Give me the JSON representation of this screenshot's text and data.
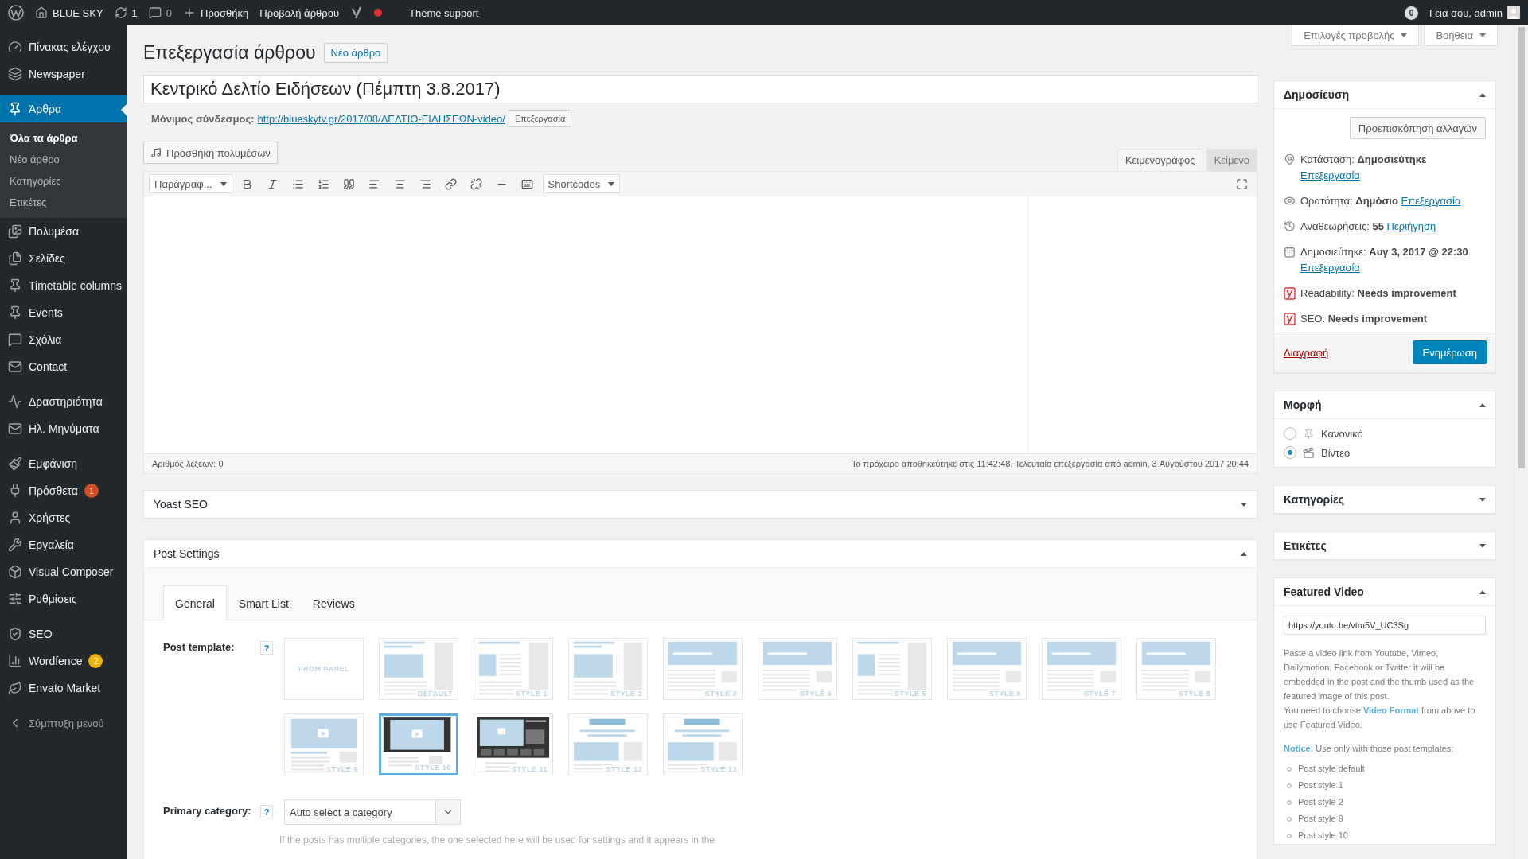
{
  "admin_bar": {
    "site": "BLUE SKY",
    "updates": "1",
    "comments": "0",
    "new": "Προσθήκη",
    "view": "Προβολή άρθρου",
    "theme_support": "Theme support",
    "notifications": "0",
    "greeting": "Γεια σου, admin"
  },
  "sidebar": {
    "groups": [
      [
        {
          "label": "Πίνακας ελέγχου",
          "selected": false
        },
        {
          "label": "Newspaper",
          "selected": false
        }
      ],
      [
        {
          "label": "Άρθρα",
          "selected": true,
          "children": [
            {
              "label": "Όλα τα άρθρα",
              "selected": true
            },
            {
              "label": "Νέο άρθρο",
              "selected": false
            },
            {
              "label": "Κατηγορίες",
              "selected": false
            },
            {
              "label": "Ετικέτες",
              "selected": false
            }
          ]
        },
        {
          "label": "Πολυμέσα",
          "selected": false
        },
        {
          "label": "Σελίδες",
          "selected": false
        },
        {
          "label": "Timetable columns",
          "selected": false
        },
        {
          "label": "Events",
          "selected": false
        },
        {
          "label": "Σχόλια",
          "selected": false
        },
        {
          "label": "Contact",
          "selected": false
        }
      ],
      [
        {
          "label": "Δραστηριότητα",
          "selected": false
        },
        {
          "label": "Ηλ. Μηνύματα",
          "selected": false
        }
      ],
      [
        {
          "label": "Εμφάνιση",
          "selected": false
        },
        {
          "label": "Πρόσθετα",
          "selected": false,
          "badge": {
            "text": "1",
            "color": "#d54e21"
          }
        },
        {
          "label": "Χρήστες",
          "selected": false
        },
        {
          "label": "Εργαλεία",
          "selected": false
        },
        {
          "label": "Visual Composer",
          "selected": false
        },
        {
          "label": "Ρυθμίσεις",
          "selected": false
        }
      ],
      [
        {
          "label": "SEO",
          "selected": false
        },
        {
          "label": "Wordfence",
          "selected": false,
          "badge": {
            "text": "2",
            "color": "#f0b400"
          }
        },
        {
          "label": "Envato Market",
          "selected": false
        }
      ]
    ],
    "collapse": "Σύμπτυξη μενού"
  },
  "screen_meta": [
    "Επιλογές προβολής",
    "Βοήθεια"
  ],
  "page_title": "Επεξεργασία άρθρου",
  "new_post": "Νέο άρθρο",
  "title": "Κεντρικό Δελτίο Ειδήσεων (Πέμπτη 3.8.2017)",
  "permalink": {
    "label": "Μόνιμος σύνδεσμος:",
    "url": "http://blueskytv.gr/2017/08/ΔΕΛΤΙΟ-ΕΙΔΗΣΕΩΝ-video/",
    "edit": "Επεξεργασία"
  },
  "editor": {
    "add_media": "Προσθήκη πολυμέσων",
    "tabs": [
      {
        "label": "Κειμενογράφος",
        "selected": true
      },
      {
        "label": "Κείμενο",
        "selected": false
      }
    ],
    "format": "Παράγραφ...",
    "shortcodes": "Shortcodes",
    "word_count": "Αριθμός λέξεων: 0",
    "draft_status": "Το πρόχειρο αποθηκεύτηκε στις 11:42:48. Τελευταία επεξεργασία από admin, 3 Αυγούστου 2017 20:44"
  },
  "yoast_box": {
    "title": "Yoast SEO",
    "expanded": false
  },
  "post_settings": {
    "title": "Post Settings",
    "expanded": true,
    "tabs": [
      {
        "label": "General",
        "selected": true
      },
      {
        "label": "Smart List",
        "selected": false
      },
      {
        "label": "Reviews",
        "selected": false
      }
    ],
    "template_label": "Post template:",
    "help": "?",
    "templates": [
      {
        "label": "FROM PANEL",
        "kind": "panel",
        "selected": false
      },
      {
        "label": "DEFAULT",
        "kind": "sidebar",
        "selected": false
      },
      {
        "label": "STYLE 1",
        "kind": "list",
        "selected": false
      },
      {
        "label": "STYLE 2",
        "kind": "sidebar",
        "selected": false
      },
      {
        "label": "STYLE 3",
        "kind": "wide",
        "selected": false
      },
      {
        "label": "STYLE 4",
        "kind": "wide",
        "selected": false
      },
      {
        "label": "STYLE 5",
        "kind": "list",
        "selected": false
      },
      {
        "label": "STYLE 6",
        "kind": "wide",
        "selected": false
      },
      {
        "label": "STYLE 7",
        "kind": "wide",
        "selected": false
      },
      {
        "label": "STYLE 8",
        "kind": "wide",
        "selected": false
      },
      {
        "label": "STYLE 9",
        "kind": "video",
        "selected": false
      },
      {
        "label": "STYLE 10",
        "kind": "dark-video",
        "selected": true
      },
      {
        "label": "STYLE 11",
        "kind": "dark-bar",
        "selected": false
      },
      {
        "label": "STYLE 12",
        "kind": "ad",
        "selected": false
      },
      {
        "label": "STYLE 13",
        "kind": "ad",
        "selected": false
      }
    ],
    "category_label": "Primary category:",
    "category_help": "?",
    "category_value": "Auto select a category",
    "category_hint": "If the posts has multiple categories, the one selected here will be used for settings and it appears in the"
  },
  "publish": {
    "title": "Δημοσίευση",
    "expanded": true,
    "preview": "Προεπισκόπηση αλλαγών",
    "rows": [
      {
        "kind": "status",
        "label": "Κατάσταση:",
        "value": "Δημοσιεύτηκε",
        "link": "Επεξεργασία"
      },
      {
        "kind": "visibility",
        "label": "Ορατότητα:",
        "value": "Δημόσιο",
        "link": "Επεξεργασία"
      },
      {
        "kind": "revisions",
        "label": "Αναθεωρήσεις:",
        "value": "55",
        "link": "Περιήγηση"
      },
      {
        "kind": "date",
        "label": "Δημοσιεύτηκε:",
        "value": "Αυγ 3, 2017 @ 22:30",
        "link": "Επεξεργασία"
      },
      {
        "kind": "yoast",
        "label": "Readability:",
        "value": "Needs improvement"
      },
      {
        "kind": "yoast",
        "label": "SEO:",
        "value": "Needs improvement"
      }
    ],
    "delete": "Διαγραφή",
    "update": "Ενημέρωση"
  },
  "format_box": {
    "title": "Μορφή",
    "expanded": true,
    "options": [
      {
        "label": "Κανονικό",
        "kind": "standard",
        "selected": false
      },
      {
        "label": "Βίντεο",
        "kind": "video",
        "selected": true
      }
    ]
  },
  "categories_box": {
    "title": "Κατηγορίες",
    "expanded": false
  },
  "tags_box": {
    "title": "Ετικέτες",
    "expanded": false
  },
  "featured_video": {
    "title": "Featured Video",
    "expanded": true,
    "value": "https://youtu.be/vtm5V_UC3Sg",
    "description": "Paste a video link from Youtube, Vimeo, Dailymotion, Facebook or Twitter it will be embedded in the post and the thumb used as the featured image of this post.",
    "instruction": "You need to choose **Video Format** from above to use Featured Video.",
    "notice": "**Notice:** Use only with those post templates:",
    "templates": [
      "Post style default",
      "Post style 1",
      "Post style 2",
      "Post style 9",
      "Post style 10"
    ]
  }
}
